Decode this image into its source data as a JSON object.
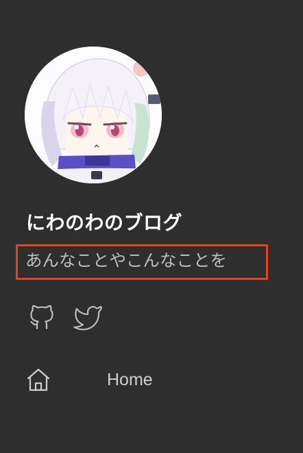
{
  "profile": {
    "avatar_icon": "anime-character-avatar",
    "blog_title": "にわのわのブログ",
    "tagline": "あんなことやこんなことを",
    "highlight_color": "#e34421"
  },
  "social": [
    {
      "icon": "github-icon"
    },
    {
      "icon": "twitter-icon"
    }
  ],
  "nav": {
    "items": [
      {
        "icon": "home-icon",
        "label": "Home"
      }
    ]
  }
}
